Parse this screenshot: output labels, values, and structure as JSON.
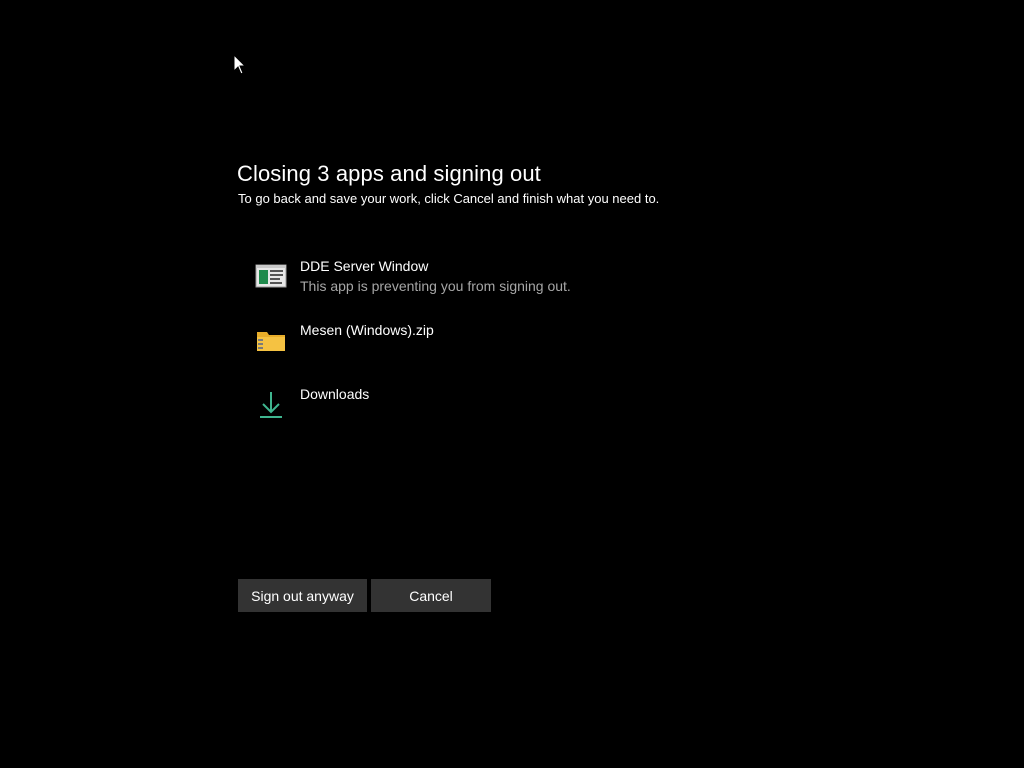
{
  "dialog": {
    "title": "Closing 3 apps and signing out",
    "subtitle": "To go back and save your work, click Cancel and finish what you need to."
  },
  "apps": [
    {
      "name": "DDE Server Window",
      "note": "This app is preventing you from signing out.",
      "icon": "window-app-icon"
    },
    {
      "name": "Mesen (Windows).zip",
      "note": "",
      "icon": "zip-folder-icon"
    },
    {
      "name": "Downloads",
      "note": "",
      "icon": "download-arrow-icon"
    }
  ],
  "buttons": {
    "sign_out_label": "Sign out anyway",
    "cancel_label": "Cancel"
  },
  "colors": {
    "background": "#000000",
    "button_bg": "#333333",
    "secondary_text": "#a6a6a6",
    "folder_yellow": "#f5c242",
    "download_green": "#3fb58f"
  }
}
